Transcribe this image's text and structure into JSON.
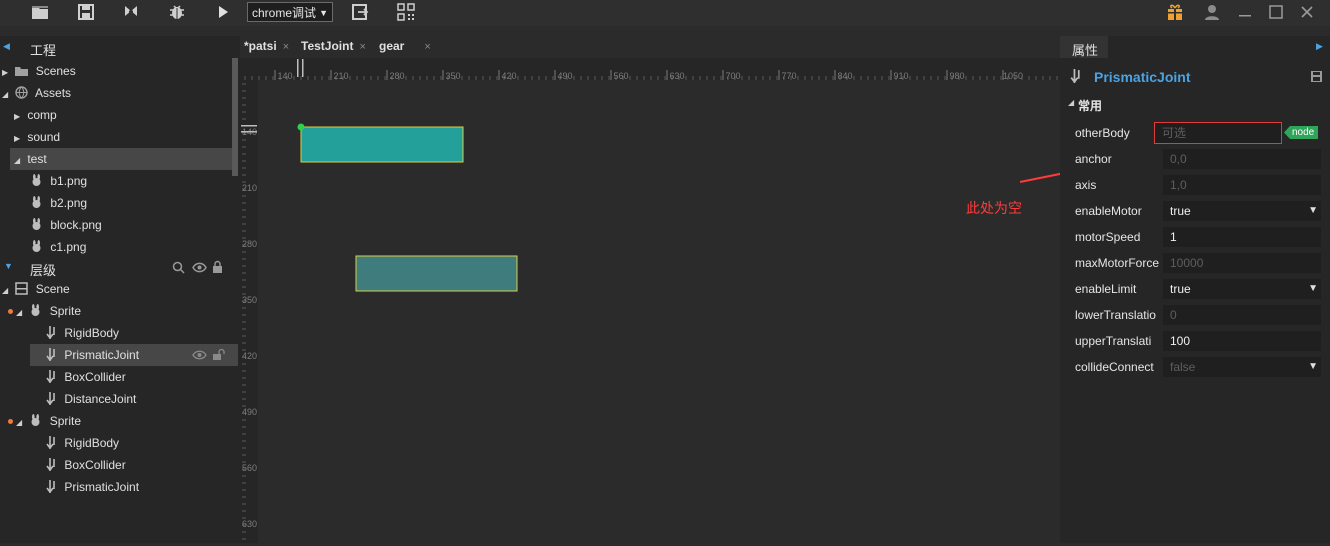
{
  "toolbar": {
    "browser_select": "chrome调试",
    "icons": [
      "folder-icon",
      "save-icon",
      "publish-icon",
      "bug-icon",
      "play-icon",
      "export-icon",
      "qrcode-icon"
    ]
  },
  "project": {
    "title": "工程",
    "items": [
      {
        "label": "Scenes"
      },
      {
        "label": "Assets"
      },
      {
        "label": "comp"
      },
      {
        "label": "sound"
      },
      {
        "label": "test"
      },
      {
        "label": "b1.png"
      },
      {
        "label": "b2.png"
      },
      {
        "label": "block.png"
      },
      {
        "label": "c1.png"
      }
    ]
  },
  "hierarchy": {
    "title": "层级",
    "items": [
      {
        "label": "Scene"
      },
      {
        "label": "Sprite"
      },
      {
        "label": "RigidBody"
      },
      {
        "label": "PrismaticJoint"
      },
      {
        "label": "BoxCollider"
      },
      {
        "label": "DistanceJoint"
      },
      {
        "label": "Sprite"
      },
      {
        "label": "RigidBody"
      },
      {
        "label": "BoxCollider"
      },
      {
        "label": "PrismaticJoint"
      }
    ]
  },
  "tabs": [
    {
      "label": "*patsi"
    },
    {
      "label": "TestJoint"
    },
    {
      "label": "gear"
    }
  ],
  "tab_close": "×",
  "ruler": {
    "h_ticks": [
      "140",
      "210",
      "280",
      "350",
      "420",
      "490",
      "560",
      "630",
      "700",
      "770",
      "840",
      "910",
      "980",
      "1050"
    ],
    "v_ticks": [
      "140",
      "210",
      "280",
      "350",
      "420",
      "490",
      "560",
      "630"
    ]
  },
  "annotation": {
    "text": "此处为空",
    "color": "#ff3b3b"
  },
  "properties": {
    "title": "属性",
    "component": "PrismaticJoint",
    "section": "常用",
    "node_badge": "node",
    "rows": [
      {
        "label": "otherBody",
        "value": "可选",
        "dim": true
      },
      {
        "label": "anchor",
        "value": "0,0",
        "dim": true
      },
      {
        "label": "axis",
        "value": "1,0",
        "dim": true
      },
      {
        "label": "enableMotor",
        "value": "true",
        "dropdown": true
      },
      {
        "label": "motorSpeed",
        "value": "1"
      },
      {
        "label": "maxMotorForce",
        "value": "10000",
        "dim": true
      },
      {
        "label": "enableLimit",
        "value": "true",
        "dropdown": true
      },
      {
        "label": "lowerTranslatio",
        "value": "0",
        "dim": true
      },
      {
        "label": "upperTranslati",
        "value": "100"
      },
      {
        "label": "collideConnect",
        "value": "false",
        "dim": true,
        "dropdown": true
      }
    ]
  },
  "colors": {
    "accent": "#4ba3e3",
    "box_teal": "#24a09a",
    "box_slate": "#3f7c7e",
    "badge_green": "#2fa55a"
  }
}
